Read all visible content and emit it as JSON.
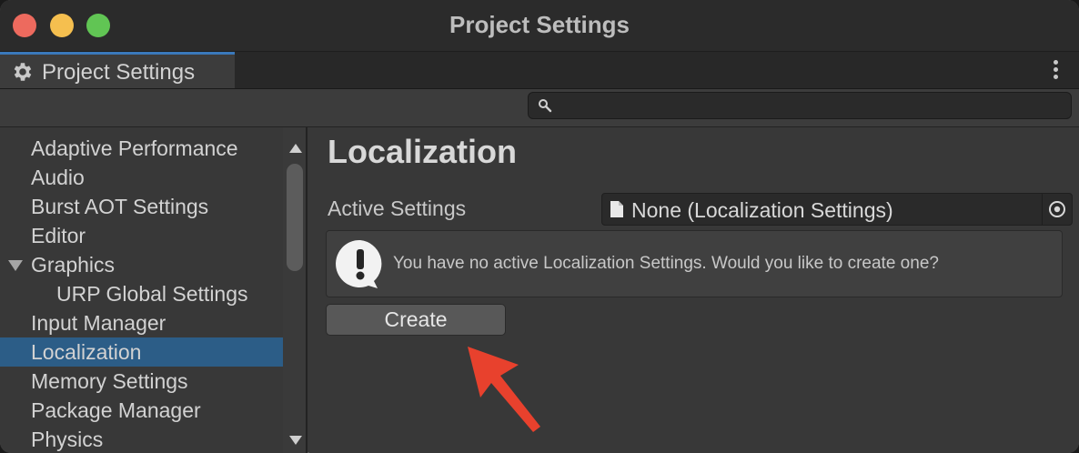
{
  "window": {
    "title": "Project Settings"
  },
  "tab": {
    "label": "Project Settings",
    "icon": "gear-icon"
  },
  "search": {
    "value": "",
    "placeholder": ""
  },
  "sidebar": {
    "items": [
      {
        "label": "Adaptive Performance",
        "indent": 0,
        "selected": false
      },
      {
        "label": "Audio",
        "indent": 0,
        "selected": false
      },
      {
        "label": "Burst AOT Settings",
        "indent": 0,
        "selected": false
      },
      {
        "label": "Editor",
        "indent": 0,
        "selected": false
      },
      {
        "label": "Graphics",
        "indent": 0,
        "selected": false,
        "expanded": true
      },
      {
        "label": "URP Global Settings",
        "indent": 1,
        "selected": false
      },
      {
        "label": "Input Manager",
        "indent": 0,
        "selected": false
      },
      {
        "label": "Localization",
        "indent": 0,
        "selected": true
      },
      {
        "label": "Memory Settings",
        "indent": 0,
        "selected": false
      },
      {
        "label": "Package Manager",
        "indent": 0,
        "selected": false
      },
      {
        "label": "Physics",
        "indent": 0,
        "selected": false
      }
    ]
  },
  "main": {
    "heading": "Localization",
    "active_settings_label": "Active Settings",
    "active_settings_value": "None (Localization Settings)",
    "help_message": "You have no active Localization Settings. Would you like to create one?",
    "create_label": "Create"
  },
  "colors": {
    "selection": "#2c5d87",
    "tab_accent": "#3a79bb",
    "annotation_arrow": "#e8412d"
  }
}
